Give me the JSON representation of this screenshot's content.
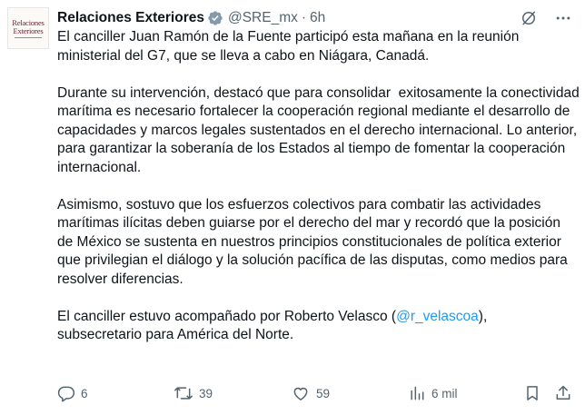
{
  "avatar": {
    "line1": "Relaciones",
    "line2": "Exteriores"
  },
  "tweet": {
    "author": "Relaciones Exteriores",
    "handle": "@SRE_mx",
    "separator": "·",
    "time": "6h",
    "paragraphs": [
      "El canciller Juan Ramón de la Fuente participó esta mañana en la reunión ministerial del G7, que se lleva a cabo en Niágara, Canadá.",
      "Durante su intervención, destacó que para consolidar  exitosamente la conectividad marítima es necesario fortalecer la cooperación regional mediante el desarrollo de capacidades y marcos legales sustentados en el derecho internacional. Lo anterior, para garantizar la soberanía de los Estados al tiempo de fomentar la cooperación internacional.",
      "Asimismo, sostuvo que los esfuerzos colectivos para combatir las actividades marítimas ilícitas deben guiarse por el derecho del mar y recordó que la posición de México se sustenta en nuestros principios constitucionales de política exterior que privilegian el diálogo y la solución pacífica de las disputas, como medios para resolver diferencias."
    ],
    "last_paragraph": {
      "before": "El canciller estuvo acompañado por Roberto Velasco (",
      "mention": "@r_velascoa",
      "after": "),\nsubsecretario para América del Norte."
    }
  },
  "actions": {
    "replies": "6",
    "retweets": "39",
    "likes": "59",
    "views": "6 mil"
  },
  "icons": {
    "header": [
      "grok-icon",
      "more-icon"
    ],
    "actions": [
      "reply-icon",
      "retweet-icon",
      "like-icon",
      "views-icon",
      "bookmark-icon",
      "share-icon"
    ]
  },
  "colors": {
    "text": "#0f1419",
    "secondary": "#536471",
    "link": "#1d9bf0",
    "verified": "#829aab"
  }
}
